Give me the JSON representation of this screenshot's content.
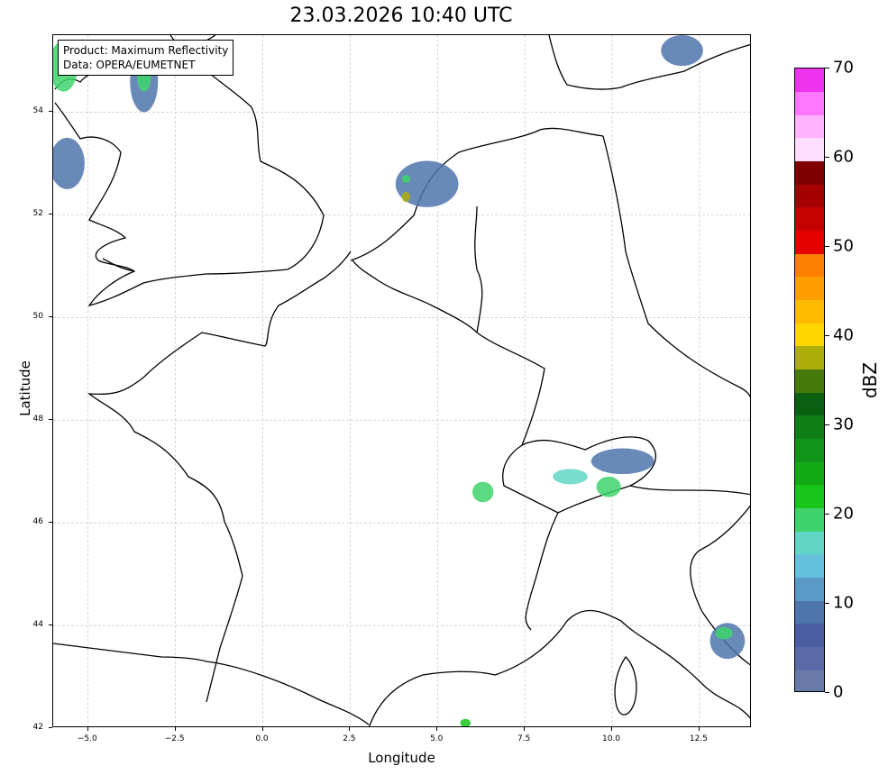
{
  "title": "23.03.2026 10:40 UTC",
  "info": {
    "product": "Product: Maximum Reflectivity",
    "source": "Data: OPERA/EUMETNET"
  },
  "axes": {
    "xlabel": "Longitude",
    "ylabel": "Latitude",
    "xlim": [
      -6,
      14
    ],
    "ylim": [
      42,
      55.5
    ],
    "xticks": [
      "−5.0",
      "−2.5",
      "0.0",
      "2.5",
      "5.0",
      "7.5",
      "10.0",
      "12.5"
    ],
    "xtick_values": [
      -5,
      -2.5,
      0,
      2.5,
      5,
      7.5,
      10,
      12.5
    ],
    "yticks": [
      "42",
      "44",
      "46",
      "48",
      "50",
      "52",
      "54"
    ],
    "ytick_values": [
      42,
      44,
      46,
      48,
      50,
      52,
      54
    ],
    "grid": true
  },
  "colorbar": {
    "label": "dBZ",
    "ticks": [
      "0",
      "10",
      "20",
      "30",
      "40",
      "50",
      "60",
      "70"
    ],
    "tick_values": [
      0,
      10,
      20,
      30,
      40,
      50,
      60,
      70
    ],
    "range": [
      0,
      70
    ],
    "step": 2.5,
    "colors": [
      "#6979a8",
      "#5a6aa6",
      "#4a5da1",
      "#4f75ad",
      "#5b9ac7",
      "#64c0dc",
      "#62d6c6",
      "#3ed36b",
      "#18c61b",
      "#12a914",
      "#10951a",
      "#0f7e16",
      "#0a6010",
      "#457a0b",
      "#aeae0a",
      "#ffd700",
      "#ffbb00",
      "#ff9e00",
      "#ff7f00",
      "#e60000",
      "#c50000",
      "#a70000",
      "#800000",
      "#ffddff",
      "#ffb3ff",
      "#ff77ff",
      "#ee33ee"
    ]
  },
  "precip": [
    {
      "lon": 4.7,
      "lat": 52.6,
      "rx": 0.9,
      "ry": 0.45,
      "color": "#4f75ad"
    },
    {
      "lon": 4.1,
      "lat": 52.35,
      "rx": 0.12,
      "ry": 0.1,
      "color": "#aeae0a"
    },
    {
      "lon": 4.1,
      "lat": 52.7,
      "rx": 0.12,
      "ry": 0.08,
      "color": "#3ed36b"
    },
    {
      "lon": -3.4,
      "lat": 54.6,
      "rx": 0.4,
      "ry": 0.6,
      "color": "#4f75ad"
    },
    {
      "lon": -3.4,
      "lat": 54.7,
      "rx": 0.2,
      "ry": 0.3,
      "color": "#3ed36b"
    },
    {
      "lon": -5.7,
      "lat": 54.9,
      "rx": 0.4,
      "ry": 0.5,
      "color": "#3ed36b"
    },
    {
      "lon": -5.6,
      "lat": 53.0,
      "rx": 0.5,
      "ry": 0.5,
      "color": "#4f75ad"
    },
    {
      "lon": 8.8,
      "lat": 46.9,
      "rx": 0.5,
      "ry": 0.15,
      "color": "#62d6c6"
    },
    {
      "lon": 10.3,
      "lat": 47.2,
      "rx": 0.9,
      "ry": 0.25,
      "color": "#4f75ad"
    },
    {
      "lon": 9.9,
      "lat": 46.7,
      "rx": 0.35,
      "ry": 0.2,
      "color": "#3ed36b"
    },
    {
      "lon": 6.3,
      "lat": 46.6,
      "rx": 0.3,
      "ry": 0.2,
      "color": "#3ed36b"
    },
    {
      "lon": 13.3,
      "lat": 43.7,
      "rx": 0.5,
      "ry": 0.35,
      "color": "#4f75ad"
    },
    {
      "lon": 13.2,
      "lat": 43.85,
      "rx": 0.25,
      "ry": 0.12,
      "color": "#3ed36b"
    },
    {
      "lon": 12.0,
      "lat": 55.2,
      "rx": 0.6,
      "ry": 0.3,
      "color": "#4f75ad"
    },
    {
      "lon": 5.8,
      "lat": 42.1,
      "rx": 0.15,
      "ry": 0.08,
      "color": "#18c61b"
    }
  ]
}
